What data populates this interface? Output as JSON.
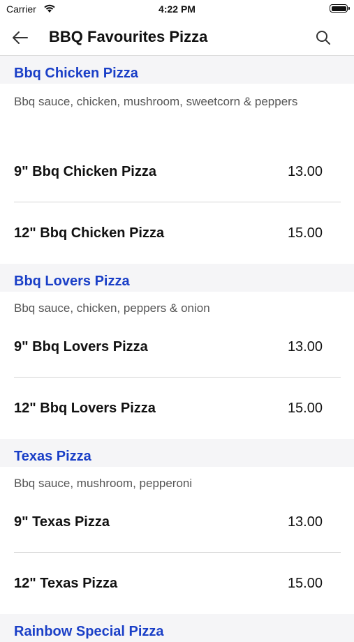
{
  "status_bar": {
    "carrier": "Carrier",
    "time": "4:22 PM"
  },
  "nav": {
    "title": "BBQ Favourites Pizza",
    "back_icon": "arrow-left-icon",
    "search_icon": "search-icon"
  },
  "colors": {
    "category_title": "#1a3fc7",
    "category_header_bg": "#f5f5f7",
    "divider": "#d4d4d4"
  },
  "categories": [
    {
      "title": "Bbq Chicken Pizza",
      "description": "Bbq sauce, chicken, mushroom, sweetcorn & peppers",
      "items": [
        {
          "name": "9\" Bbq Chicken Pizza",
          "price": "13.00"
        },
        {
          "name": "12\" Bbq Chicken Pizza",
          "price": "15.00"
        }
      ]
    },
    {
      "title": "Bbq Lovers Pizza",
      "description": "Bbq sauce, chicken, peppers & onion",
      "items": [
        {
          "name": "9\" Bbq Lovers Pizza",
          "price": "13.00"
        },
        {
          "name": "12\" Bbq Lovers Pizza",
          "price": "15.00"
        }
      ]
    },
    {
      "title": "Texas Pizza",
      "description": "Bbq sauce, mushroom, pepperoni",
      "items": [
        {
          "name": "9\" Texas Pizza",
          "price": "13.00"
        },
        {
          "name": "12\" Texas Pizza",
          "price": "15.00"
        }
      ]
    },
    {
      "title": "Rainbow Special Pizza"
    }
  ]
}
